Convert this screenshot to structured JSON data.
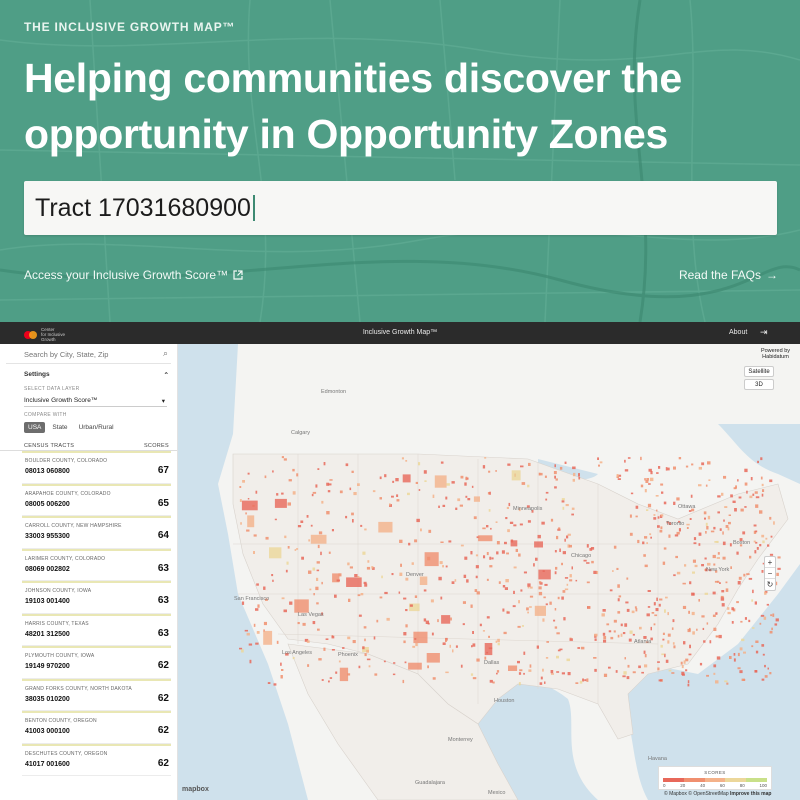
{
  "hero": {
    "eyebrow": "THE INCLUSIVE GROWTH MAP™",
    "headline_line1": "Helping communities discover the",
    "headline_line2": "opportunity in Opportunity Zones",
    "search_value": "Tract 17031680900",
    "link_left": "Access your Inclusive Growth Score™",
    "link_left_icon": "external-link-icon",
    "link_right": "Read the FAQs",
    "link_right_icon": "arrow-right-icon",
    "bg_color": "#4f9e86"
  },
  "appbar": {
    "logo_text_1": "Center",
    "logo_text_2": "for Inclusive",
    "logo_text_3": "Growth",
    "title": "Inclusive Growth Map™",
    "about": "About",
    "exit_icon": "logout-icon"
  },
  "sidebar": {
    "search_placeholder": "Search by City, State, Zip",
    "settings": "Settings",
    "data_layer_label": "SELECT DATA LAYER",
    "data_layer_value": "Inclusive Growth Score™",
    "compare_label": "COMPARE WITH",
    "compare_options": [
      "USA",
      "State",
      "Urban/Rural"
    ],
    "compare_selected": "USA",
    "list_header_left": "CENSUS TRACTS",
    "list_header_right": "SCORES",
    "tracts": [
      {
        "county": "BOULDER COUNTY, COLORADO",
        "id": "08013 060800",
        "score": "67"
      },
      {
        "county": "ARAPAHOE COUNTY, COLORADO",
        "id": "08005 006200",
        "score": "65"
      },
      {
        "county": "CARROLL COUNTY, NEW HAMPSHIRE",
        "id": "33003 955300",
        "score": "64"
      },
      {
        "county": "LARIMER COUNTY, COLORADO",
        "id": "08069 002802",
        "score": "63"
      },
      {
        "county": "JOHNSON COUNTY, IOWA",
        "id": "19103 001400",
        "score": "63"
      },
      {
        "county": "HARRIS COUNTY, TEXAS",
        "id": "48201 312500",
        "score": "63"
      },
      {
        "county": "PLYMOUTH COUNTY, IOWA",
        "id": "19149 970200",
        "score": "62"
      },
      {
        "county": "GRAND FORKS COUNTY, NORTH DAKOTA",
        "id": "38035 010200",
        "score": "62"
      },
      {
        "county": "BENTON COUNTY, OREGON",
        "id": "41003 000100",
        "score": "62"
      },
      {
        "county": "DESCHUTES COUNTY, OREGON",
        "id": "41017 001600",
        "score": "62"
      }
    ]
  },
  "map": {
    "powered_1": "Powered by",
    "powered_2": "Habidatum",
    "satellite": "Satellite",
    "three_d": "3D",
    "zoom_in": "+",
    "zoom_out": "−",
    "compass": "↻",
    "cities": [
      "Edmonton",
      "Calgary",
      "Minneapolis",
      "Ottawa",
      "Toronto",
      "Chicago",
      "Boston",
      "Denver",
      "New York",
      "San Francisco",
      "Las Vegas",
      "Los Angeles",
      "Phoenix",
      "Dallas",
      "Atlanta",
      "Houston",
      "Monterrey",
      "Guadalajara",
      "Mexico",
      "Havana"
    ],
    "legend_title": "SCORES",
    "legend_ticks": [
      "0",
      "20",
      "40",
      "60",
      "80",
      "100"
    ],
    "legend_colors": [
      "#e8685a",
      "#f08f6f",
      "#f4b28a",
      "#ecd79a",
      "#c9e089"
    ],
    "attribution_1": "© Mapbox © OpenStreetMap",
    "attribution_2": "Improve this map",
    "mapbox": "mapbox"
  }
}
